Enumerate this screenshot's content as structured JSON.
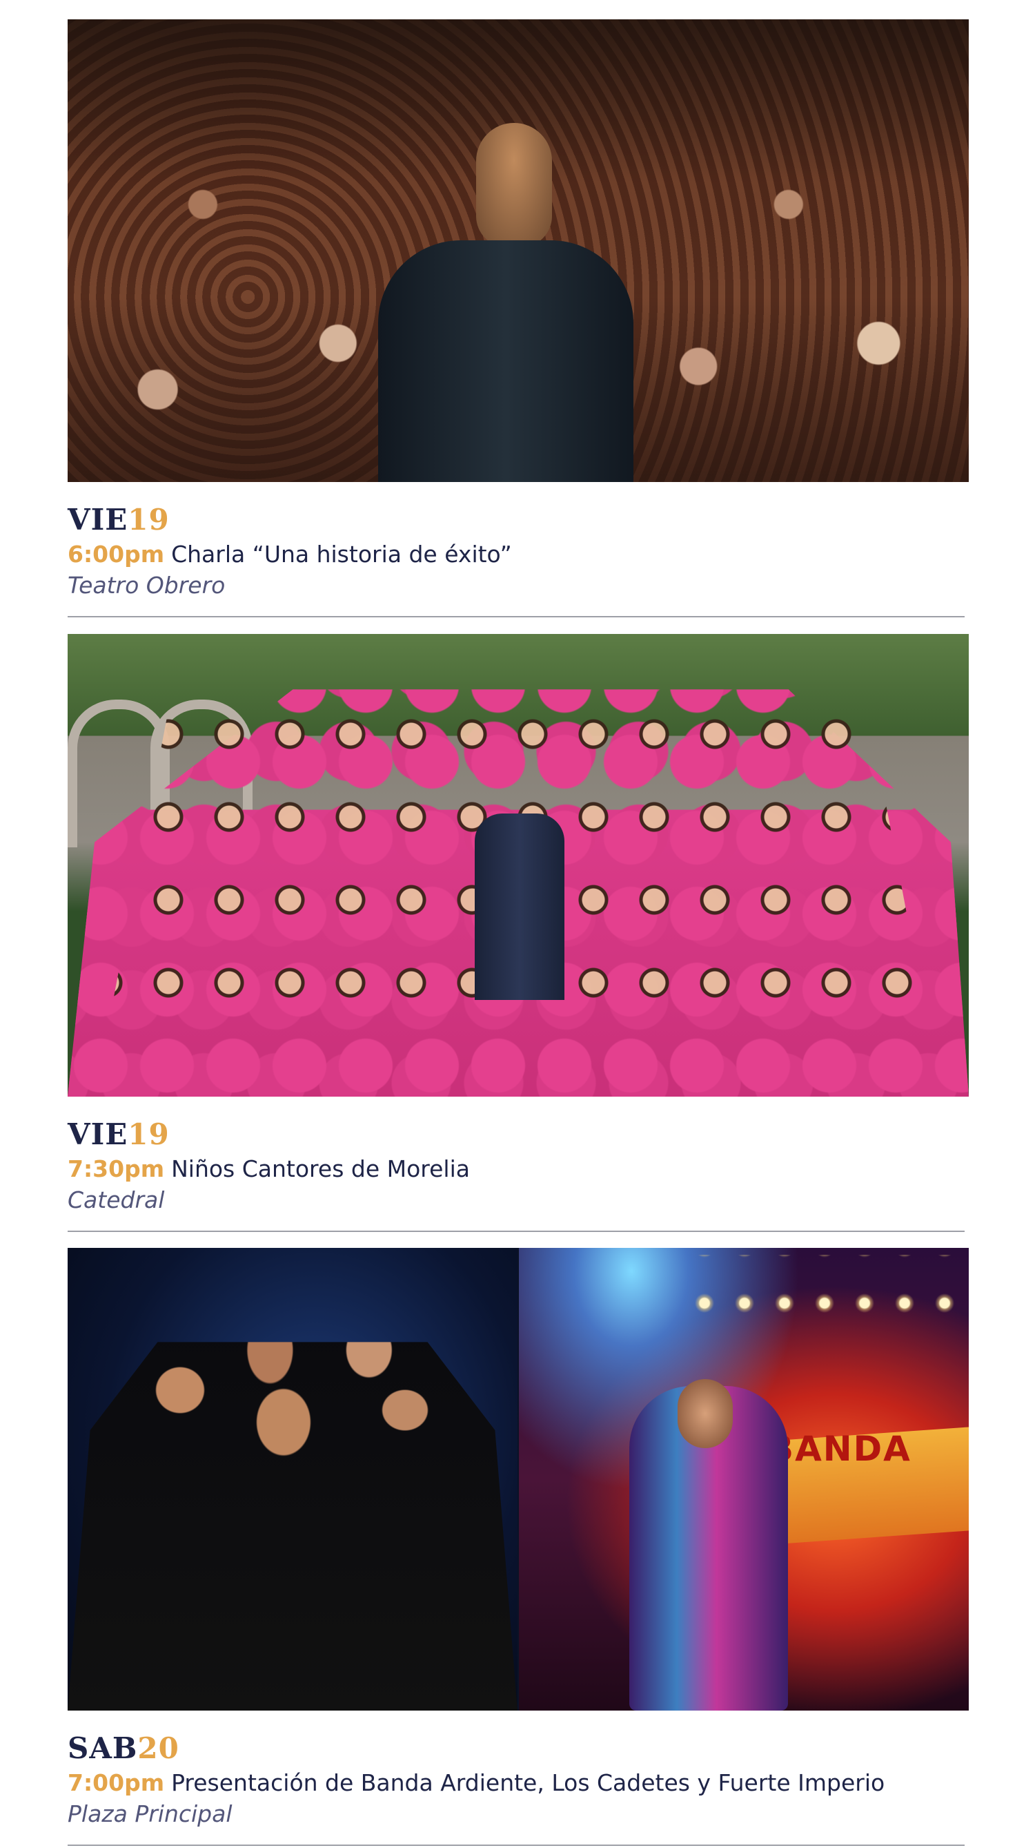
{
  "events": [
    {
      "day_name": "VIE",
      "day_number": "19",
      "time": "6:00pm",
      "title": "Charla “Una historia de  éxito”",
      "venue": "Teatro Obrero",
      "image": "photo-speaker-audience"
    },
    {
      "day_name": "VIE",
      "day_number": "19",
      "time": "7:30pm",
      "title": "Niños Cantores de Morelia",
      "venue": "Catedral",
      "image": "photo-childrens-choir"
    },
    {
      "day_name": "SAB",
      "day_number": "20",
      "time": "7:00pm",
      "title": "Presentación de Banda Ardiente, Los Cadetes y Fuerte Imperio",
      "venue": "Plaza Principal",
      "image": "photo-bands",
      "photo_sign_text": "BANDA"
    }
  ],
  "colors": {
    "navy": "#1e2447",
    "gold": "#e4a449",
    "venue_gray": "#53567a",
    "rule": "#9ea0a8"
  }
}
